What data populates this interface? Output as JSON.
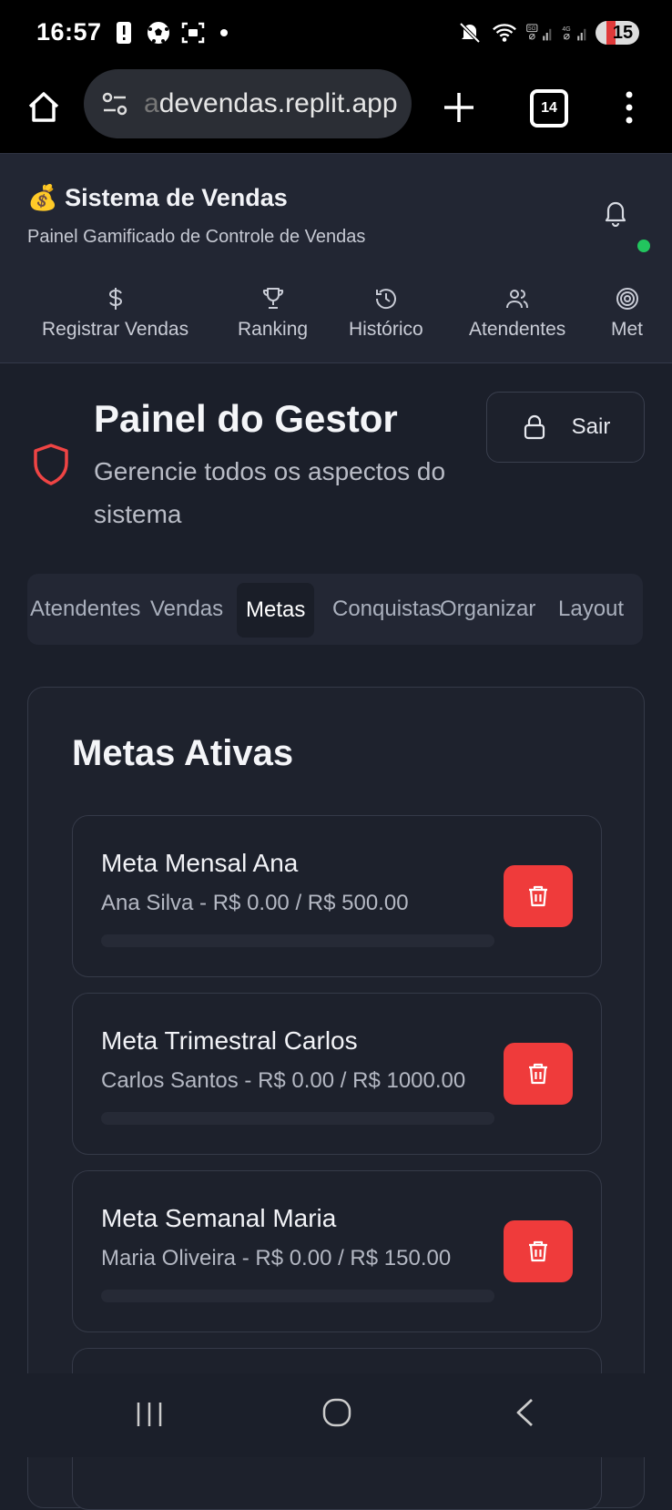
{
  "status_bar": {
    "time": "16:57",
    "battery": "15",
    "icons_left": [
      "alert-icon",
      "soccer-ball-icon",
      "screenshot-icon",
      "dot-icon"
    ],
    "icons_right": [
      "mute-icon",
      "wifi-icon",
      "signal-5g-icon",
      "signal-4g-icon",
      "battery-icon"
    ]
  },
  "browser": {
    "url_faded": "a",
    "url": "devendas.replit.app",
    "tab_count": "14"
  },
  "header": {
    "emoji": "💰",
    "title": "Sistema de Vendas",
    "subtitle": "Painel Gamificado de Controle de Vendas"
  },
  "nav": {
    "items": [
      {
        "label": "Registrar Vendas",
        "icon": "dollar-icon"
      },
      {
        "label": "Ranking",
        "icon": "trophy-icon"
      },
      {
        "label": "Histórico",
        "icon": "history-icon"
      },
      {
        "label": "Atendentes",
        "icon": "users-icon"
      },
      {
        "label": "Met",
        "icon": "target-icon"
      }
    ]
  },
  "page": {
    "title": "Painel do Gestor",
    "description": "Gerencie todos os aspectos do sistema",
    "logout_label": "Sair"
  },
  "tabs": [
    {
      "label": "Atendentes"
    },
    {
      "label": "Vendas"
    },
    {
      "label": "Metas",
      "active": true
    },
    {
      "label": "Conquistas"
    },
    {
      "label": "Organizar"
    },
    {
      "label": "Layout"
    }
  ],
  "goals_panel": {
    "title": "Metas Ativas",
    "goals": [
      {
        "name": "Meta Mensal Ana",
        "detail": "Ana Silva - R$ 0.00 / R$ 500.00",
        "progress": 0
      },
      {
        "name": "Meta Trimestral Carlos",
        "detail": "Carlos Santos - R$ 0.00 / R$ 1000.00",
        "progress": 0
      },
      {
        "name": "Meta Semanal Maria",
        "detail": "Maria Oliveira - R$ 0.00 / R$ 150.00",
        "progress": 0
      }
    ]
  },
  "colors": {
    "accent_red": "#ef3b3b",
    "online_green": "#22c55e",
    "background": "#1b1f2a"
  }
}
